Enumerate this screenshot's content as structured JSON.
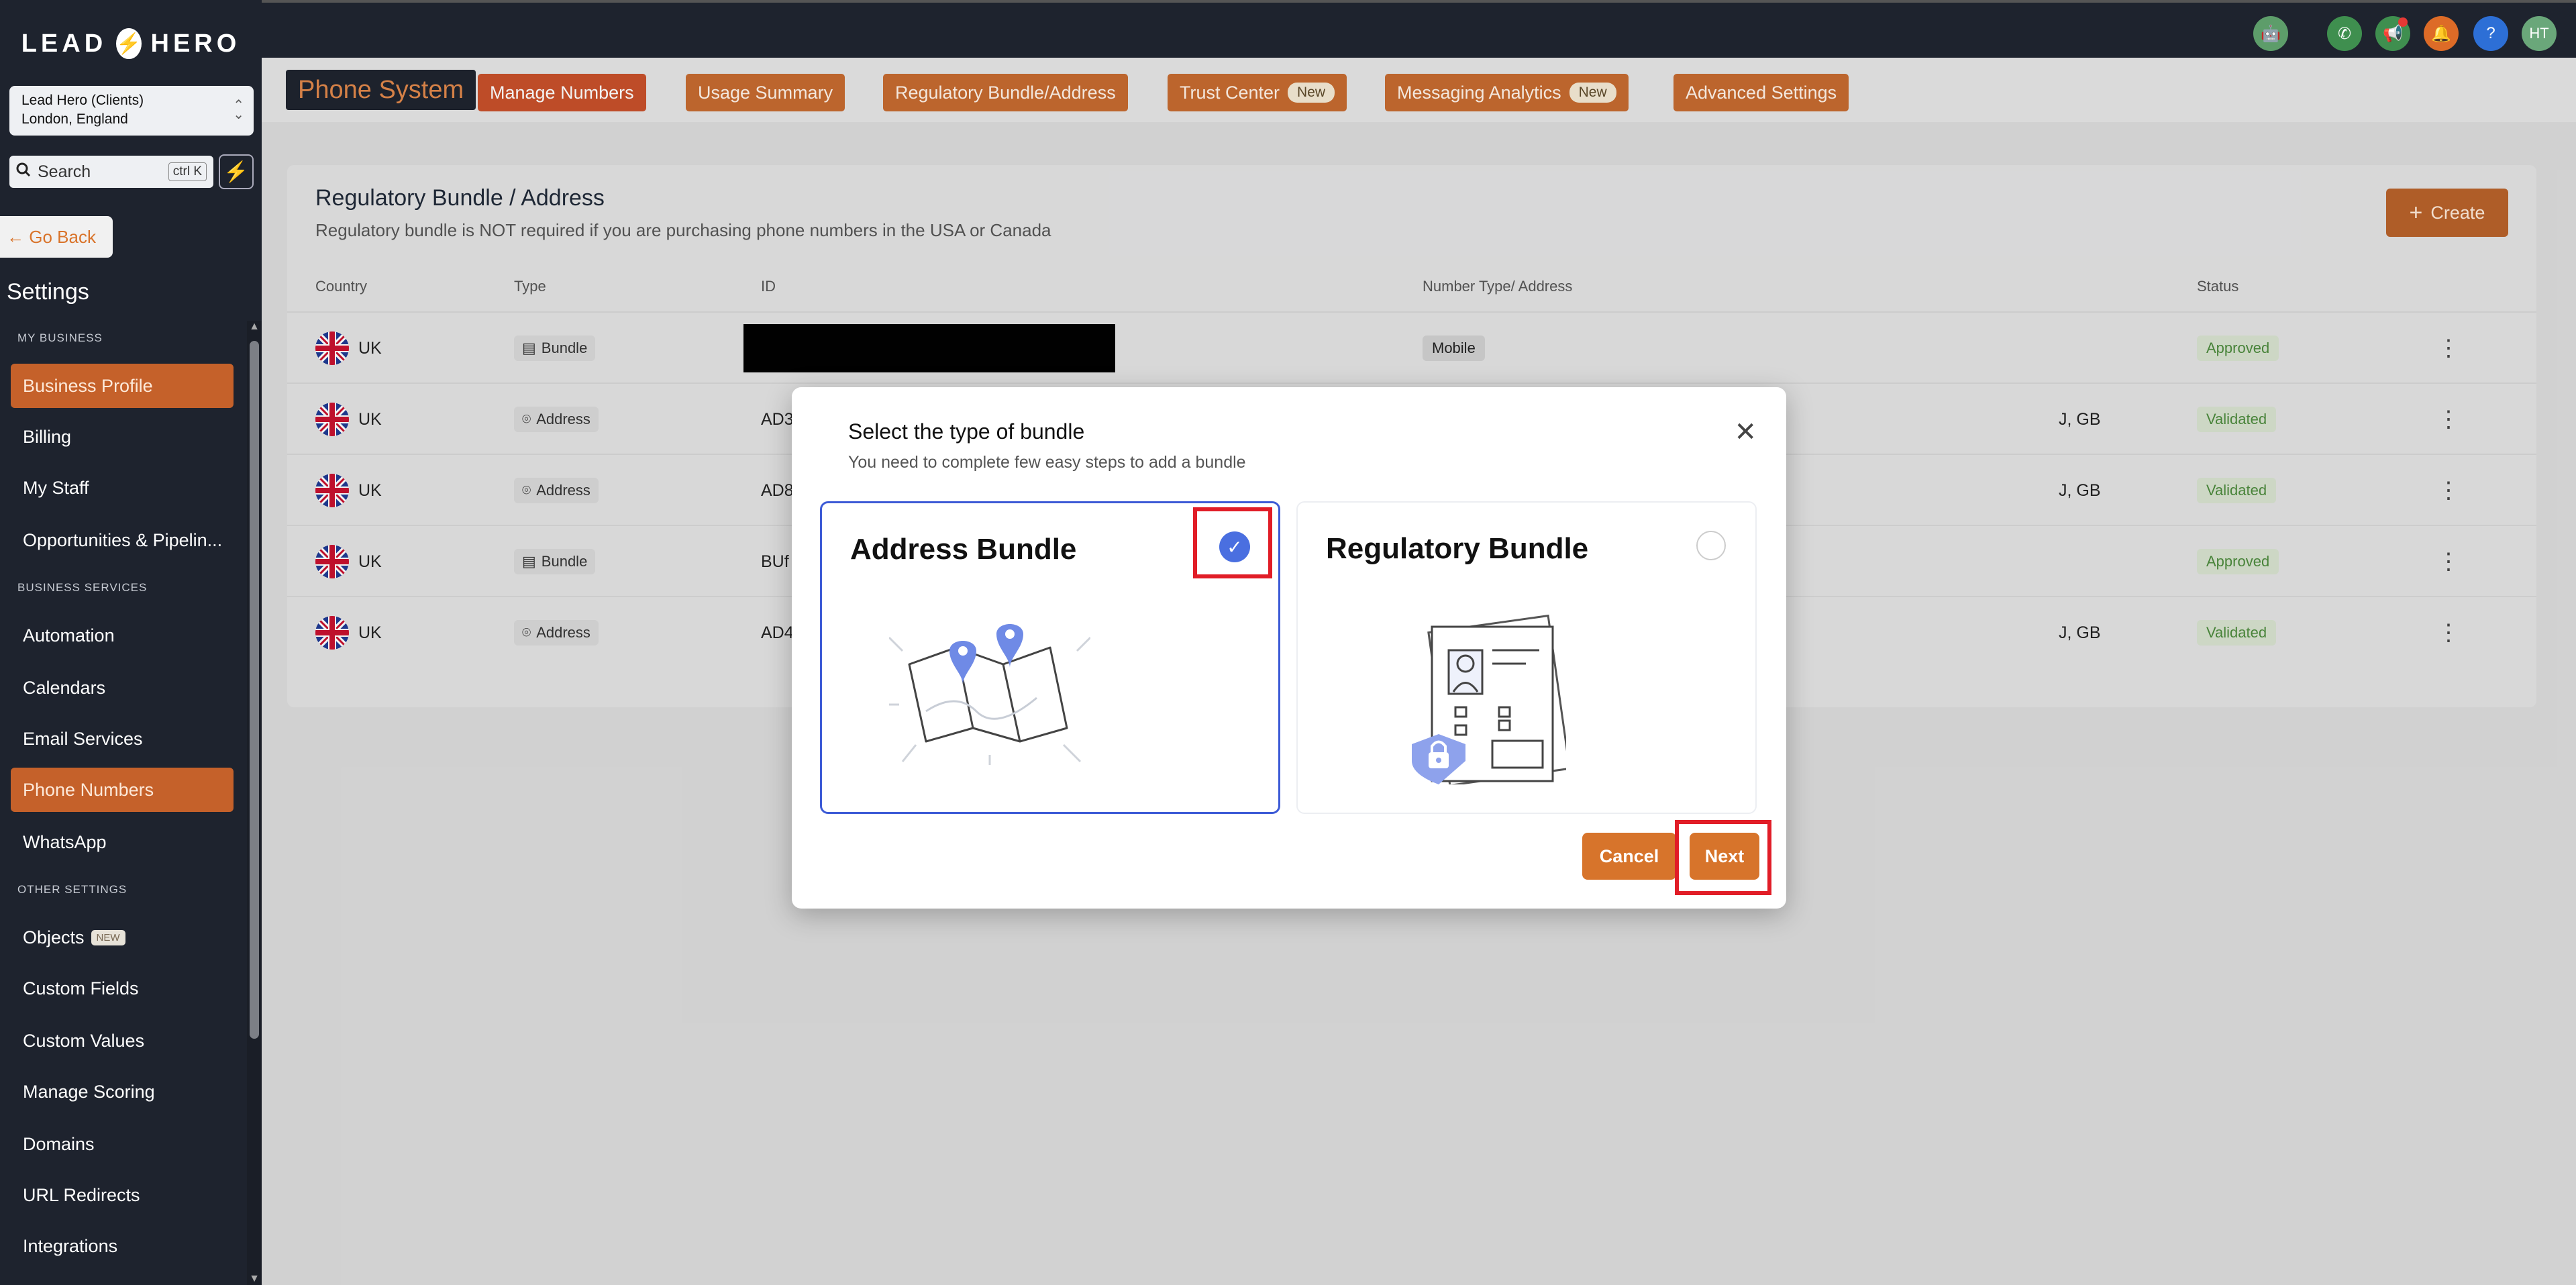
{
  "sidebar": {
    "logo_left": "LEAD",
    "logo_right": "HERO",
    "account_name": "Lead Hero (Clients)",
    "account_location": "London, England",
    "search_label": "Search",
    "search_shortcut": "ctrl K",
    "go_back": "Go Back",
    "settings_title": "Settings",
    "sections": {
      "my_business": "MY BUSINESS",
      "business_services": "BUSINESS SERVICES",
      "other_settings": "OTHER SETTINGS"
    },
    "items": {
      "business_profile": "Business Profile",
      "billing": "Billing",
      "my_staff": "My Staff",
      "opportunities": "Opportunities & Pipelin...",
      "automation": "Automation",
      "calendars": "Calendars",
      "email_services": "Email Services",
      "phone_numbers": "Phone Numbers",
      "whatsapp": "WhatsApp",
      "objects": "Objects",
      "objects_badge": "NEW",
      "custom_fields": "Custom Fields",
      "custom_values": "Custom Values",
      "manage_scoring": "Manage Scoring",
      "domains": "Domains",
      "url_redirects": "URL Redirects",
      "integrations": "Integrations"
    }
  },
  "topbar": {
    "avatar_initials": "HT",
    "help": "?"
  },
  "tabs": {
    "title": "Phone System",
    "manage_numbers": "Manage Numbers",
    "usage_summary": "Usage Summary",
    "regulatory": "Regulatory Bundle/Address",
    "trust_center": "Trust Center",
    "messaging_analytics": "Messaging Analytics",
    "new_badge": "New",
    "advanced_settings": "Advanced Settings"
  },
  "card": {
    "title": "Regulatory Bundle / Address",
    "subtitle": "Regulatory bundle is NOT required if you are purchasing phone numbers in the USA or Canada",
    "create": "Create",
    "headers": {
      "country": "Country",
      "type": "Type",
      "id": "ID",
      "number_type": "Number Type/ Address",
      "status": "Status"
    },
    "rows": [
      {
        "country": "UK",
        "type": "Bundle",
        "id": "",
        "number": "Mobile",
        "status": "Approved"
      },
      {
        "country": "UK",
        "type": "Address",
        "id": "AD3",
        "number": "J, GB",
        "status": "Validated"
      },
      {
        "country": "UK",
        "type": "Address",
        "id": "AD8",
        "number": "J, GB",
        "status": "Validated"
      },
      {
        "country": "UK",
        "type": "Bundle",
        "id": "BUf",
        "number": "",
        "status": "Approved"
      },
      {
        "country": "UK",
        "type": "Address",
        "id": "AD4",
        "number": "J, GB",
        "status": "Validated"
      }
    ]
  },
  "modal": {
    "title": "Select the type of bundle",
    "subtitle": "You need to complete few easy steps to add a bundle",
    "option_address": "Address Bundle",
    "option_regulatory": "Regulatory Bundle",
    "cancel": "Cancel",
    "next": "Next"
  },
  "colors": {
    "accent": "#c8612a",
    "sidebar_bg": "#1e232e",
    "selected_border": "#3d5bd6",
    "highlight_red": "#e11d27"
  }
}
